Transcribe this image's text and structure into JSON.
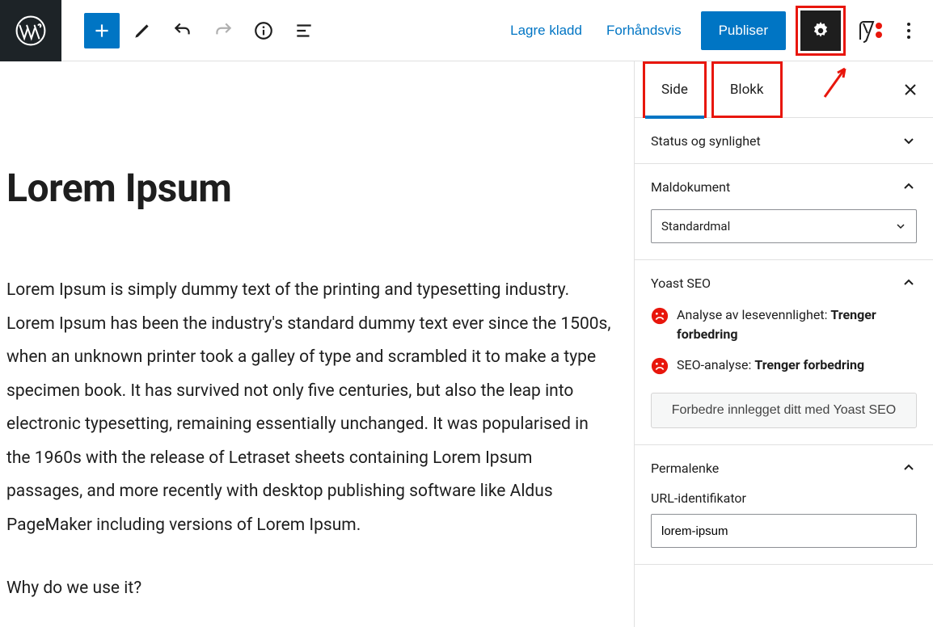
{
  "toolbar": {
    "save_draft": "Lagre kladd",
    "preview": "Forhåndsvis",
    "publish": "Publiser"
  },
  "editor": {
    "title": "Lorem Ipsum",
    "paragraph1": "Lorem Ipsum is simply dummy text of the printing and typesetting industry. Lorem Ipsum has been the industry's standard dummy text ever since the 1500s, when an unknown printer took a galley of type and scrambled it to make a type specimen book. It has survived not only five centuries, but also the leap into electronic typesetting, remaining essentially unchanged. It was popularised in the 1960s with the release of Letraset sheets containing Lorem Ipsum passages, and more recently with desktop publishing software like Aldus PageMaker including versions of Lorem Ipsum.",
    "paragraph2": "Why do we use it?"
  },
  "sidebar": {
    "tabs": {
      "page": "Side",
      "block": "Blokk"
    },
    "status": {
      "title": "Status og synlighet"
    },
    "template": {
      "title": "Maldokument",
      "value": "Standardmal"
    },
    "yoast": {
      "title": "Yoast SEO",
      "readability_label": "Analyse av lesevennlighet: ",
      "readability_status": "Trenger forbedring",
      "seo_label": "SEO-analyse: ",
      "seo_status": "Trenger forbedring",
      "improve_btn": "Forbedre innlegget ditt med Yoast SEO"
    },
    "permalink": {
      "title": "Permalenke",
      "url_label": "URL-identifikator",
      "url_value": "lorem-ipsum"
    }
  }
}
